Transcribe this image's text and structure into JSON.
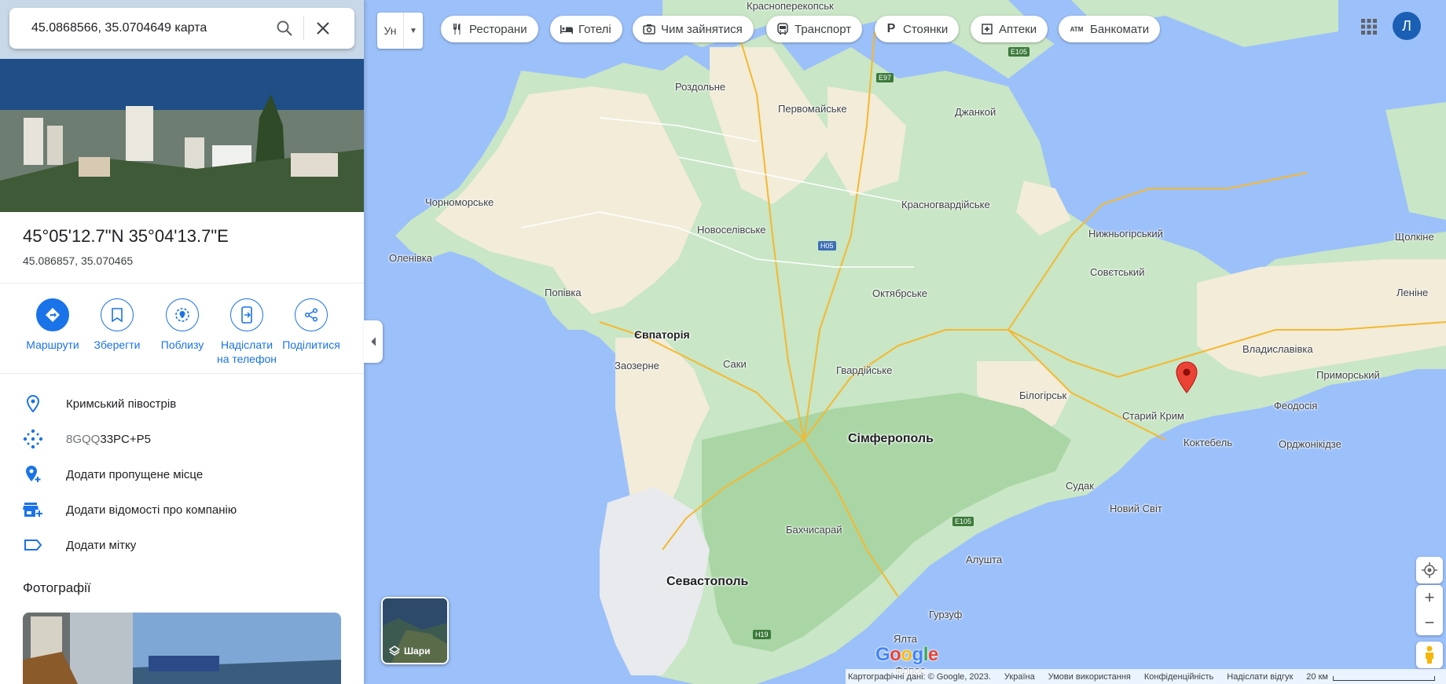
{
  "search": {
    "query": "45.0868566, 35.0704649 карта"
  },
  "place": {
    "title": "45°05'12.7\"N 35°04'13.7\"E",
    "decimal": "45.086857, 35.070465"
  },
  "actions": [
    {
      "label": "Маршрути"
    },
    {
      "label": "Зберегти"
    },
    {
      "label": "Поблизу"
    },
    {
      "label": "Надіслати на телефон"
    },
    {
      "label": "Поділитися"
    }
  ],
  "info": {
    "region": "Кримський півострів",
    "pluscode_prefix": "8GQQ",
    "pluscode_suffix": "33PC+P5",
    "add_place": "Додати пропущене місце",
    "add_business": "Додати відомості про компанію",
    "add_label": "Додати мітку"
  },
  "photos_title": "Фотографії",
  "language_chip": "Ун",
  "chips": [
    "Ресторани",
    "Готелі",
    "Чим зайнятися",
    "Транспорт",
    "Стоянки",
    "Аптеки",
    "Банкомати"
  ],
  "account_initial": "Л",
  "layers_label": "Шари",
  "brand": {
    "g1": "G",
    "o1": "o",
    "o2": "o",
    "g2": "g",
    "l": "l",
    "e": "e"
  },
  "footer": {
    "attribution": "Картографічні дані: © Google, 2023.",
    "country": "Україна",
    "terms": "Умови використання",
    "privacy": "Конфіденційність",
    "feedback": "Надіслати відгук",
    "scale": "20 км"
  },
  "map_labels": {
    "krasnoperekopsk": "Красноперекопськ",
    "rozdolne": "Роздольне",
    "pervomaiske": "Первомайське",
    "dzhankoi": "Джанкой",
    "chornomorske": "Чорноморське",
    "krasnohvardiiske": "Красногвардійське",
    "novoselivske": "Новоселівське",
    "olenivka": "Оленівка",
    "nyzhnohirskyi": "Нижньогірський",
    "shcholkine": "Щолкіне",
    "sovietskyi": "Совєтський",
    "lenine": "Леніне",
    "popivka": "Попівка",
    "oktiabrske": "Октябрське",
    "yevpatoriia": "Євпаторія",
    "vladyslavivka": "Владиславівка",
    "zaozerne": "Заозерне",
    "saky": "Саки",
    "hvardiiske": "Гвардійське",
    "prymorskyi": "Приморський",
    "bilohirsk": "Білогірськ",
    "feodosiia": "Феодосія",
    "staryi_krym": "Старий Крим",
    "simferopol": "Сімферополь",
    "koktebel": "Коктебель",
    "ordzhonikidze": "Орджонікідзе",
    "sudak": "Судак",
    "novyi_svit": "Новий Світ",
    "bakhchysarai": "Бахчисарай",
    "sevastopol": "Севастополь",
    "alushta": "Алушта",
    "hurzuf": "Гурзуф",
    "yalta": "Ялта",
    "foros": "Форос"
  },
  "road_shields": {
    "e97": "E97",
    "e105a": "E105",
    "h05": "H05",
    "e105b": "E105",
    "h19": "H19"
  },
  "colors": {
    "accent": "#1a73e8",
    "water": "#9cc0f9",
    "land_green": "#c8e6c4",
    "land_beige": "#f2ecd9",
    "pin": "#ea4335"
  }
}
